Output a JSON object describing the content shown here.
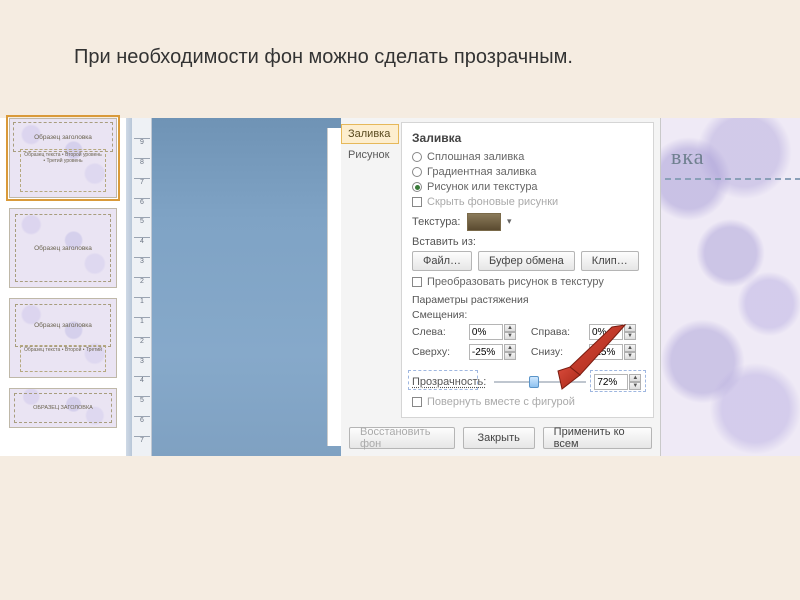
{
  "caption": "При необходимости фон можно сделать прозрачным.",
  "thumbnails": {
    "t1_title": "Образец заголовка",
    "t1_sub": "Образец текста\n• Второй уровень\n• Третий уровень",
    "t2_title": "Образец заголовка",
    "t3_title": "Образец заголовка",
    "t3_sub": "Образец текста\n• Второй\n• Третий",
    "t4_title": "ОБРАЗЕЦ ЗАГОЛОВКА"
  },
  "ruler_marks": [
    "9",
    "8",
    "7",
    "6",
    "5",
    "4",
    "3",
    "2",
    "1",
    "1",
    "2",
    "3",
    "4",
    "5",
    "6",
    "7"
  ],
  "tabs": {
    "fill": "Заливка",
    "picture": "Рисунок"
  },
  "panel": {
    "title": "Заливка",
    "r_solid": "Сплошная заливка",
    "r_gradient": "Градиентная заливка",
    "r_picture": "Рисунок или текстура",
    "chk_hide": "Скрыть фоновые рисунки",
    "texture_label": "Текстура:",
    "insert_from": "Вставить из:",
    "btn_file": "Файл…",
    "btn_clip": "Буфер обмена",
    "btn_clipart": "Клип…",
    "chk_tile": "Преобразовать рисунок в текстуру",
    "stretch_head": "Параметры растяжения",
    "offsets_head": "Смещения:",
    "off_left_l": "Слева:",
    "off_left_v": "0%",
    "off_right_l": "Справа:",
    "off_right_v": "0%",
    "off_top_l": "Сверху:",
    "off_top_v": "-25%",
    "off_bottom_l": "Снизу:",
    "off_bottom_v": "-25%",
    "transparency_l": "Прозрачность:",
    "transparency_v": "72%",
    "chk_rotate": "Повернуть вместе с фигурой"
  },
  "footer": {
    "reset": "Восстановить фон",
    "close": "Закрыть",
    "apply_all": "Применить ко всем"
  },
  "preview_title": "вка",
  "colors": {
    "slider_pos_pct": 38
  }
}
